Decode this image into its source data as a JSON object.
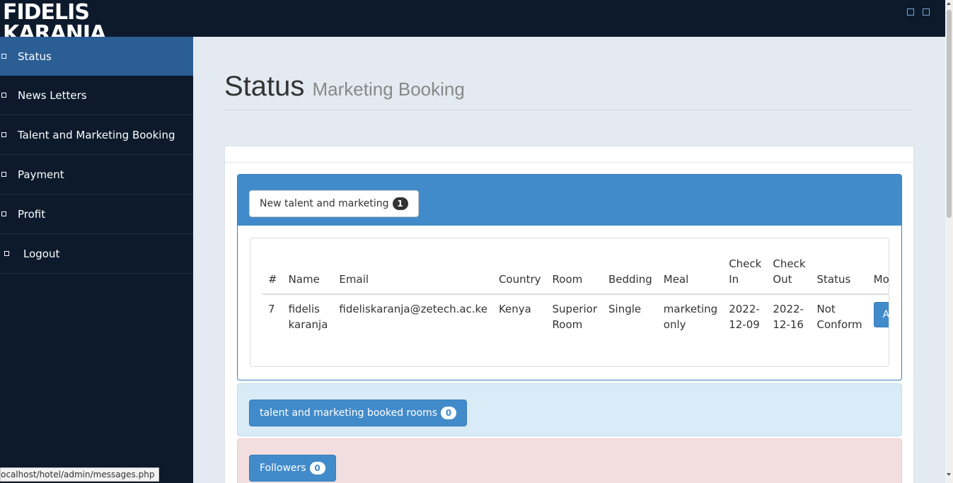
{
  "brand": {
    "line1": "FIDELIS",
    "line2": "KARANJA"
  },
  "sidebar": {
    "items": [
      {
        "label": "Status",
        "icon": "square-icon",
        "active": true
      },
      {
        "label": "News Letters",
        "icon": "square-icon"
      },
      {
        "label": "Talent and Marketing Booking",
        "icon": "square-icon"
      },
      {
        "label": "Payment",
        "icon": "square-icon"
      },
      {
        "label": "Profit",
        "icon": "square-icon"
      },
      {
        "label": "Logout",
        "icon": "square-icon"
      }
    ]
  },
  "page": {
    "title": "Status",
    "subtitle": "Marketing Booking"
  },
  "new_booking": {
    "button_label": "New talent and marketing",
    "count": "1",
    "table": {
      "headers": [
        "#",
        "Name",
        "Email",
        "Country",
        "Room",
        "Bedding",
        "Meal",
        "Check In",
        "Check Out",
        "Status",
        "More"
      ],
      "rows": [
        {
          "id": "7",
          "name": "fidelis karanja",
          "email": "fideliskaranja@zetech.ac.ke",
          "country": "Kenya",
          "room": "Superior Room",
          "bedding": "Single",
          "meal": "marketing only",
          "check_in": "2022-12-09",
          "check_out": "2022-12-16",
          "status": "Not Conform",
          "action": "Action"
        }
      ]
    }
  },
  "booked_rooms": {
    "button_label": "talent and marketing booked rooms",
    "count": "0"
  },
  "followers": {
    "button_label": "Followers",
    "count": "0"
  },
  "status_bar": {
    "url": "ocalhost/hotel/admin/messages.php"
  },
  "colors": {
    "sidebar_bg": "#0c1a2c",
    "active_item": "#2a5e95",
    "primary": "#428bca",
    "info_bg": "#d8ebf6",
    "danger_bg": "#f2dede"
  }
}
